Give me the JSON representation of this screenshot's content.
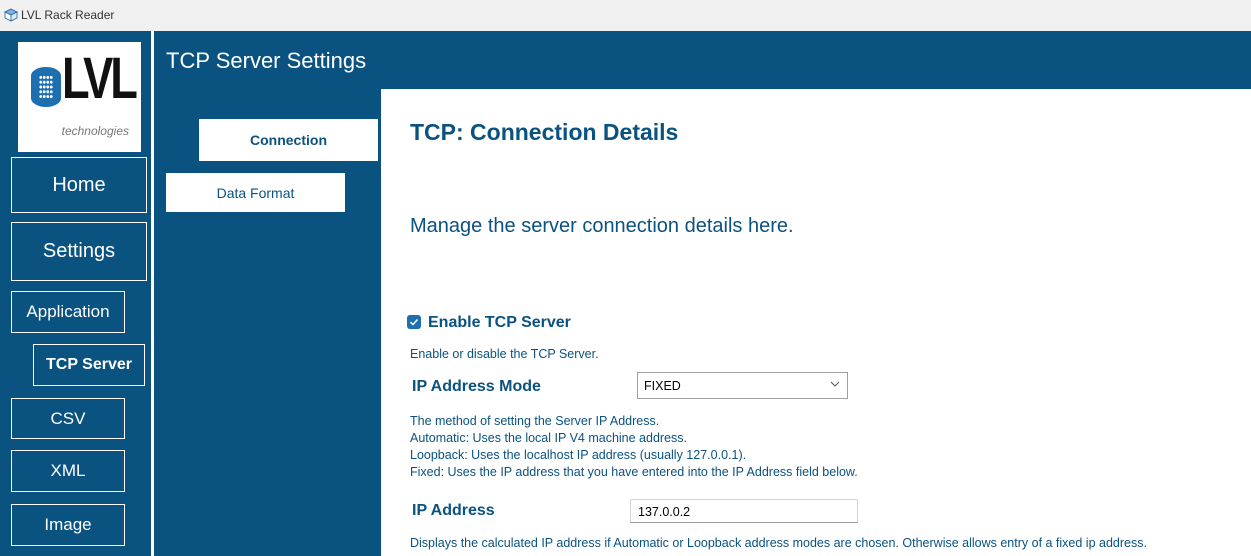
{
  "window": {
    "title": "LVL Rack Reader",
    "app_icon": "box-icon"
  },
  "colors": {
    "navy": "#0a5280",
    "accent": "#1d6fb0"
  },
  "logo": {
    "brand": "LVL",
    "tagline": "technologies"
  },
  "leftnav": {
    "home": "Home",
    "settings": "Settings",
    "application": "Application",
    "tcp_server": "TCP Server",
    "csv": "CSV",
    "xml": "XML",
    "image": "Image"
  },
  "header": {
    "title": "TCP Server Settings"
  },
  "subnav": {
    "connection": "Connection",
    "data_format": "Data Format",
    "active": "Connection"
  },
  "main": {
    "title": "TCP: Connection Details",
    "description": "Manage the server connection details here.",
    "enable": {
      "label": "Enable TCP Server",
      "checked": true,
      "help": "Enable or disable the TCP Server."
    },
    "ip_mode": {
      "label": "IP Address Mode",
      "value": "FIXED",
      "help": [
        "The method of setting the Server IP Address.",
        "Automatic: Uses the local IP V4 machine address.",
        "Loopback: Uses the localhost IP address (usually 127.0.0.1).",
        "Fixed:  Uses the IP address that you have entered into the IP Address field below."
      ]
    },
    "ip_address": {
      "label": "IP Address",
      "value": "137.0.0.2",
      "help": "Displays the calculated IP address if Automatic or Loopback address modes are chosen.  Otherwise allows entry of a fixed ip address."
    }
  }
}
